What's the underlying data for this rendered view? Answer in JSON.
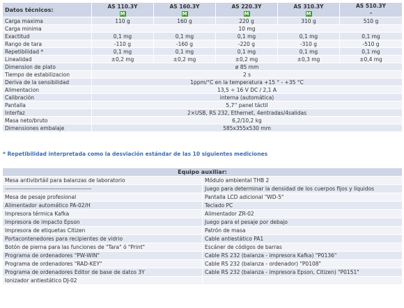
{
  "tech": {
    "header_label": "Datos técnicos:",
    "models": [
      {
        "name": "AS 110.3Y",
        "badge": "M"
      },
      {
        "name": "AS 160.3Y",
        "badge": "M"
      },
      {
        "name": "AS 220.3Y",
        "badge": "M"
      },
      {
        "name": "AS 310.3Y",
        "badge": "M"
      },
      {
        "name": "AS 510.3Y",
        "badge": "-"
      }
    ],
    "rows": [
      {
        "label": "Carga maxima",
        "values": [
          "110 g",
          "160 g",
          "220 g",
          "310 g",
          "510 g"
        ]
      },
      {
        "label": "Carga minima",
        "merged": "10 mg"
      },
      {
        "label": "Exactitud",
        "values": [
          "0,1 mg",
          "0,1 mg",
          "0,1 mg",
          "0,1 mg",
          "0,1 mg"
        ]
      },
      {
        "label": "Rango de tara",
        "values": [
          "-110 g",
          "-160 g",
          "-220 g",
          "-310 g",
          "-510 g"
        ]
      },
      {
        "label": "Repetibilidad *",
        "values": [
          "0,1 mg",
          "0,1 mg",
          "0,1 mg",
          "0,1 mg",
          "0,1 mg"
        ]
      },
      {
        "label": "Linealidad",
        "values": [
          "±0,2 mg",
          "±0,2 mg",
          "±0,2 mg",
          "±0,3 mg",
          "±0,4 mg"
        ]
      },
      {
        "label": "Dimension de plato",
        "merged": "ø 85 mm"
      },
      {
        "label": "Tiempo de estabilizacion",
        "merged": "2 s"
      },
      {
        "label": "Deriva de la sensibilidad",
        "merged": "1ppm/°C en la temperatura +15 ° - +35 °C"
      },
      {
        "label": "Alimentacion",
        "merged": "13,5 ÷ 16 V DC / 2,1 A"
      },
      {
        "label": "Calibración",
        "merged": "interna (automática)"
      },
      {
        "label": "Pantalla",
        "merged": "5,7'' panel táctil"
      },
      {
        "label": "Interfaz",
        "merged": "2×USB, RS 232, Ethernet, 4entradas/4salidas"
      },
      {
        "label": "Masa neto/bruto",
        "merged": "6,2/10,2 kg"
      },
      {
        "label": "Dimensiones embalaje",
        "merged": "585x355x530 mm"
      }
    ]
  },
  "note": "* Repetibilidad interpretada como la desviación estándar de las 10 siguientes mediciones",
  "aux": {
    "title": "Equipo auxiliar:",
    "rows": [
      [
        "Mesa antivibrtáil para balanzas de laboratorio",
        "Módulo ambiental THB 2"
      ],
      [
        "----------------------------------------------",
        "Juego para determinar la densidad de los cuerpos fijos y líquidos"
      ],
      [
        "Mesa de pesaje profesional",
        "Pantalla LCD adicional \"WD-5\""
      ],
      [
        "Alimentador automático PA-02/H",
        "Teclado PC"
      ],
      [
        "Impresora térmica Kafka",
        "Alimentador ZR-02"
      ],
      [
        "Impresora de impacto Epson",
        "Juego para el pesaje por debajo"
      ],
      [
        "Impresora de etiquetas Citizen",
        "Patrón de masa"
      ],
      [
        "Portacontenedores para recipientes de vidrio",
        "Cable antiestático PA1"
      ],
      [
        "Botón de pierna para las funciones de \"Tara\" ó \"Print\"",
        "Escáner de códigos de barras"
      ],
      [
        "Programa de ordenadores \"PW-WIN\"",
        "Cable RS 232 (balanza - impresora Kafka) \"P0136\""
      ],
      [
        "Programa de ordenadores \"RAD-KEY\"",
        "Cable RS 232 (balanza - ordenador) \"P0108\""
      ],
      [
        "Programa de ordenadores Editor de base de datos 3Y",
        "Cable RS 232 (balanza - impresora Epson, Citizen) \"P0151\""
      ],
      [
        "Ionizador antiestático DJ-02",
        ""
      ]
    ]
  },
  "colors": {
    "header_bg": "#cdd5e6",
    "row_odd": "#e2e7f1",
    "row_even": "#f1f3f8",
    "badge_green": "#3e9a2c",
    "note_blue": "#3b6eb4"
  }
}
